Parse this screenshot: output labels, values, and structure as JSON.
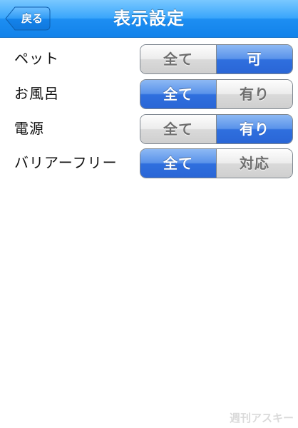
{
  "navbar": {
    "title": "表示設定",
    "back_label": "戻る"
  },
  "filters": [
    {
      "label": "ペット",
      "options": [
        "全て",
        "可"
      ],
      "selected_index": 1
    },
    {
      "label": "お風呂",
      "options": [
        "全て",
        "有り"
      ],
      "selected_index": 0
    },
    {
      "label": "電源",
      "options": [
        "全て",
        "有り"
      ],
      "selected_index": 1
    },
    {
      "label": "バリアーフリー",
      "options": [
        "全て",
        "対応"
      ],
      "selected_index": 0
    }
  ],
  "watermark": "週刊アスキー",
  "colors": {
    "navbar": "#2a98f5",
    "selected_segment": "#3b78e2",
    "unselected_segment": "#e2e2e2"
  }
}
